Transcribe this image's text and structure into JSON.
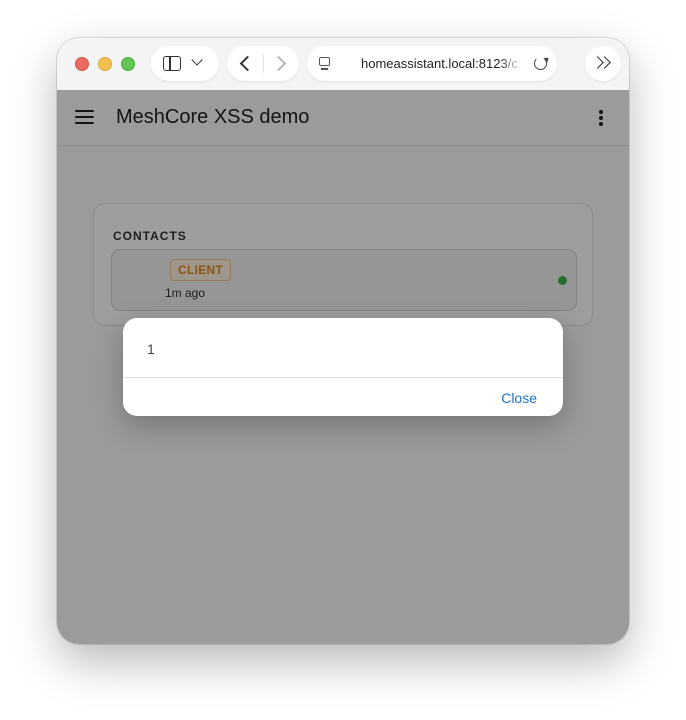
{
  "browser": {
    "url": "homeassistant.local:8123/c"
  },
  "app": {
    "title": "MeshCore XSS demo"
  },
  "contacts_card": {
    "title": "CONTACTS",
    "contacts": [
      {
        "badge": "CLIENT",
        "last_seen": "1m ago",
        "status_color": "#3cb043"
      }
    ]
  },
  "alert_dialog": {
    "message": "1",
    "close_label": "Close"
  },
  "colors": {
    "badge_text": "#e08a1e",
    "link_blue": "#1a73c8",
    "online_green": "#3cb043"
  }
}
